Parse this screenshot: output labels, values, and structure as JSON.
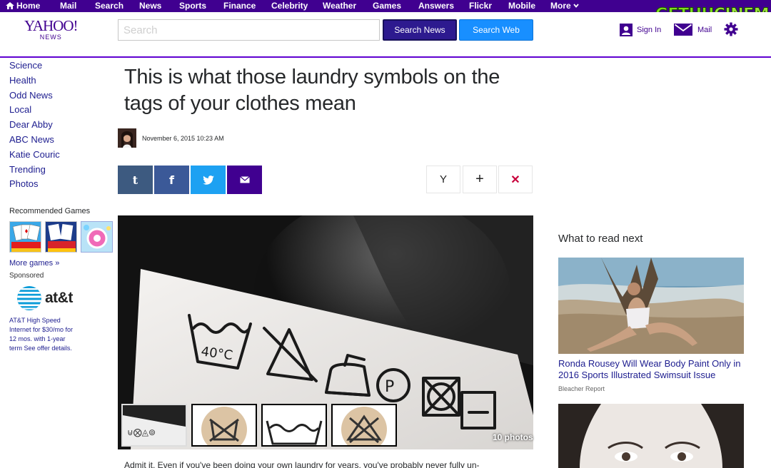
{
  "topnav": {
    "items": [
      "Home",
      "Mail",
      "Search",
      "News",
      "Sports",
      "Finance",
      "Celebrity",
      "Weather",
      "Games",
      "Answers",
      "Flickr",
      "Mobile",
      "More"
    ]
  },
  "watermark": {
    "part1": "GETHU",
    "part2": "CINEMA"
  },
  "header": {
    "logo_line1": "YAHOO!",
    "logo_line2": "NEWS",
    "search_placeholder": "Search",
    "search_news_label": "Search News",
    "search_web_label": "Search Web",
    "signin_label": "Sign In",
    "mail_label": "Mail"
  },
  "sidebar": {
    "items": [
      "Science",
      "Health",
      "Odd News",
      "Local",
      "Dear Abby",
      "ABC News",
      "Katie Couric",
      "Trending",
      "Photos"
    ],
    "games_title": "Recommended Games",
    "more_games": "More games »",
    "sponsored": "Sponsored",
    "att_brand": "at&t",
    "att_copy": "AT&T High Speed Internet for $30/mo for 12 mos. with 1-year term See offer details."
  },
  "article": {
    "headline": "This is what those laundry symbols on the tags of your clothes mean",
    "date": "November 6, 2015 10:23 AM",
    "share": {
      "tumblr": "t",
      "facebook": "f"
    },
    "actions": {
      "yahoo": "Y",
      "add": "+",
      "close": "✕"
    },
    "photo_count": "10 photos",
    "tag_temp": "40°C",
    "lede": "Admit it. Even if you've been doing your own laundry for years, you've probably never fully un-"
  },
  "rail": {
    "title": "What to read next",
    "story1_headline": "Ronda Rousey Will Wear Body Paint Only in 2016 Sports Illustrated Swimsuit Issue",
    "story1_source": "Bleacher Report"
  },
  "colors": {
    "yahoo_purple": "#400090",
    "search_news_bg": "#2d1a8f",
    "search_web_bg": "#188fff",
    "link_blue": "#1d1d8f",
    "close_red": "#c8003b"
  }
}
